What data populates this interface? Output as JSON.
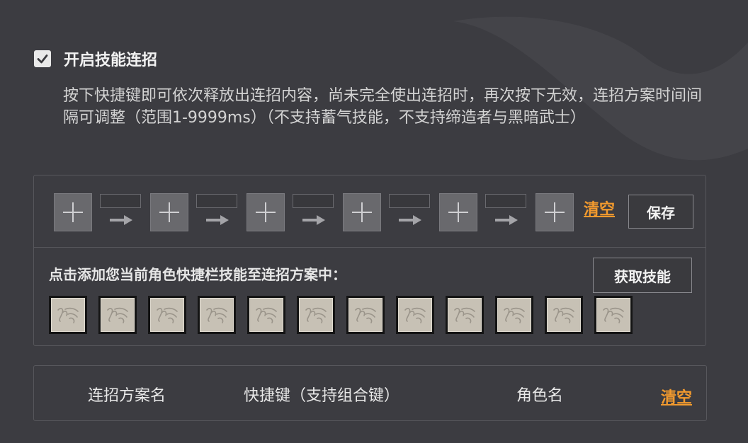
{
  "enable": {
    "checked": true,
    "label": "开启技能连招"
  },
  "description": "按下快捷键即可依次释放出连招内容，尚未完全使出连招时，再次按下无效，连招方案时间间隔可调整（范围1-9999ms）（不支持蓄气技能，不支持缔造者与黑暗武士）",
  "combo": {
    "slots": [
      {
        "icon": "plus-icon"
      },
      {
        "icon": "plus-icon"
      },
      {
        "icon": "plus-icon"
      },
      {
        "icon": "plus-icon"
      },
      {
        "icon": "plus-icon"
      },
      {
        "icon": "plus-icon"
      }
    ],
    "intervals": [
      "",
      "",
      "",
      "",
      ""
    ],
    "clear_label": "清空",
    "save_label": "保存"
  },
  "skills": {
    "hint": "点击添加您当前角色快捷栏技能至连招方案中：",
    "fetch_label": "获取技能",
    "items": [
      {
        "icon": "skill-placeholder-icon"
      },
      {
        "icon": "skill-placeholder-icon"
      },
      {
        "icon": "skill-placeholder-icon"
      },
      {
        "icon": "skill-placeholder-icon"
      },
      {
        "icon": "skill-placeholder-icon"
      },
      {
        "icon": "skill-placeholder-icon"
      },
      {
        "icon": "skill-placeholder-icon"
      },
      {
        "icon": "skill-placeholder-icon"
      },
      {
        "icon": "skill-placeholder-icon"
      },
      {
        "icon": "skill-placeholder-icon"
      },
      {
        "icon": "skill-placeholder-icon"
      },
      {
        "icon": "skill-placeholder-icon"
      }
    ]
  },
  "table": {
    "headers": [
      "连招方案名",
      "快捷键（支持组合键）",
      "角色名"
    ],
    "clear_label": "清空"
  },
  "colors": {
    "accent": "#f29a2e",
    "background": "#3c3c41",
    "border": "#57575c"
  }
}
